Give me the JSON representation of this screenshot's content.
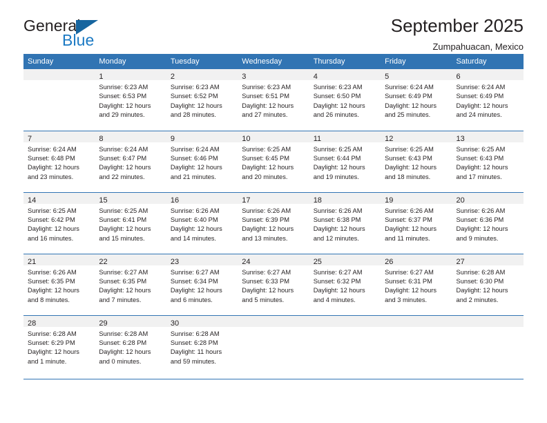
{
  "brand": {
    "name_top": "General",
    "name_bottom": "Blue",
    "flag_icon": "triangle-flag-icon",
    "accent_color": "#1b79c3"
  },
  "header": {
    "title": "September 2025",
    "subtitle": "Zumpahuacan, Mexico"
  },
  "theme": {
    "header_blue": "#3174b3",
    "daynum_strip": "#f1f1f1",
    "text": "#231f20"
  },
  "calendar": {
    "weekdays": [
      "Sunday",
      "Monday",
      "Tuesday",
      "Wednesday",
      "Thursday",
      "Friday",
      "Saturday"
    ],
    "weeks": [
      [
        {
          "day": ""
        },
        {
          "day": "1",
          "sunrise": "Sunrise: 6:23 AM",
          "sunset": "Sunset: 6:53 PM",
          "daylight_line1": "Daylight: 12 hours",
          "daylight_line2": "and 29 minutes."
        },
        {
          "day": "2",
          "sunrise": "Sunrise: 6:23 AM",
          "sunset": "Sunset: 6:52 PM",
          "daylight_line1": "Daylight: 12 hours",
          "daylight_line2": "and 28 minutes."
        },
        {
          "day": "3",
          "sunrise": "Sunrise: 6:23 AM",
          "sunset": "Sunset: 6:51 PM",
          "daylight_line1": "Daylight: 12 hours",
          "daylight_line2": "and 27 minutes."
        },
        {
          "day": "4",
          "sunrise": "Sunrise: 6:23 AM",
          "sunset": "Sunset: 6:50 PM",
          "daylight_line1": "Daylight: 12 hours",
          "daylight_line2": "and 26 minutes."
        },
        {
          "day": "5",
          "sunrise": "Sunrise: 6:24 AM",
          "sunset": "Sunset: 6:49 PM",
          "daylight_line1": "Daylight: 12 hours",
          "daylight_line2": "and 25 minutes."
        },
        {
          "day": "6",
          "sunrise": "Sunrise: 6:24 AM",
          "sunset": "Sunset: 6:49 PM",
          "daylight_line1": "Daylight: 12 hours",
          "daylight_line2": "and 24 minutes."
        }
      ],
      [
        {
          "day": "7",
          "sunrise": "Sunrise: 6:24 AM",
          "sunset": "Sunset: 6:48 PM",
          "daylight_line1": "Daylight: 12 hours",
          "daylight_line2": "and 23 minutes."
        },
        {
          "day": "8",
          "sunrise": "Sunrise: 6:24 AM",
          "sunset": "Sunset: 6:47 PM",
          "daylight_line1": "Daylight: 12 hours",
          "daylight_line2": "and 22 minutes."
        },
        {
          "day": "9",
          "sunrise": "Sunrise: 6:24 AM",
          "sunset": "Sunset: 6:46 PM",
          "daylight_line1": "Daylight: 12 hours",
          "daylight_line2": "and 21 minutes."
        },
        {
          "day": "10",
          "sunrise": "Sunrise: 6:25 AM",
          "sunset": "Sunset: 6:45 PM",
          "daylight_line1": "Daylight: 12 hours",
          "daylight_line2": "and 20 minutes."
        },
        {
          "day": "11",
          "sunrise": "Sunrise: 6:25 AM",
          "sunset": "Sunset: 6:44 PM",
          "daylight_line1": "Daylight: 12 hours",
          "daylight_line2": "and 19 minutes."
        },
        {
          "day": "12",
          "sunrise": "Sunrise: 6:25 AM",
          "sunset": "Sunset: 6:43 PM",
          "daylight_line1": "Daylight: 12 hours",
          "daylight_line2": "and 18 minutes."
        },
        {
          "day": "13",
          "sunrise": "Sunrise: 6:25 AM",
          "sunset": "Sunset: 6:43 PM",
          "daylight_line1": "Daylight: 12 hours",
          "daylight_line2": "and 17 minutes."
        }
      ],
      [
        {
          "day": "14",
          "sunrise": "Sunrise: 6:25 AM",
          "sunset": "Sunset: 6:42 PM",
          "daylight_line1": "Daylight: 12 hours",
          "daylight_line2": "and 16 minutes."
        },
        {
          "day": "15",
          "sunrise": "Sunrise: 6:25 AM",
          "sunset": "Sunset: 6:41 PM",
          "daylight_line1": "Daylight: 12 hours",
          "daylight_line2": "and 15 minutes."
        },
        {
          "day": "16",
          "sunrise": "Sunrise: 6:26 AM",
          "sunset": "Sunset: 6:40 PM",
          "daylight_line1": "Daylight: 12 hours",
          "daylight_line2": "and 14 minutes."
        },
        {
          "day": "17",
          "sunrise": "Sunrise: 6:26 AM",
          "sunset": "Sunset: 6:39 PM",
          "daylight_line1": "Daylight: 12 hours",
          "daylight_line2": "and 13 minutes."
        },
        {
          "day": "18",
          "sunrise": "Sunrise: 6:26 AM",
          "sunset": "Sunset: 6:38 PM",
          "daylight_line1": "Daylight: 12 hours",
          "daylight_line2": "and 12 minutes."
        },
        {
          "day": "19",
          "sunrise": "Sunrise: 6:26 AM",
          "sunset": "Sunset: 6:37 PM",
          "daylight_line1": "Daylight: 12 hours",
          "daylight_line2": "and 11 minutes."
        },
        {
          "day": "20",
          "sunrise": "Sunrise: 6:26 AM",
          "sunset": "Sunset: 6:36 PM",
          "daylight_line1": "Daylight: 12 hours",
          "daylight_line2": "and 9 minutes."
        }
      ],
      [
        {
          "day": "21",
          "sunrise": "Sunrise: 6:26 AM",
          "sunset": "Sunset: 6:35 PM",
          "daylight_line1": "Daylight: 12 hours",
          "daylight_line2": "and 8 minutes."
        },
        {
          "day": "22",
          "sunrise": "Sunrise: 6:27 AM",
          "sunset": "Sunset: 6:35 PM",
          "daylight_line1": "Daylight: 12 hours",
          "daylight_line2": "and 7 minutes."
        },
        {
          "day": "23",
          "sunrise": "Sunrise: 6:27 AM",
          "sunset": "Sunset: 6:34 PM",
          "daylight_line1": "Daylight: 12 hours",
          "daylight_line2": "and 6 minutes."
        },
        {
          "day": "24",
          "sunrise": "Sunrise: 6:27 AM",
          "sunset": "Sunset: 6:33 PM",
          "daylight_line1": "Daylight: 12 hours",
          "daylight_line2": "and 5 minutes."
        },
        {
          "day": "25",
          "sunrise": "Sunrise: 6:27 AM",
          "sunset": "Sunset: 6:32 PM",
          "daylight_line1": "Daylight: 12 hours",
          "daylight_line2": "and 4 minutes."
        },
        {
          "day": "26",
          "sunrise": "Sunrise: 6:27 AM",
          "sunset": "Sunset: 6:31 PM",
          "daylight_line1": "Daylight: 12 hours",
          "daylight_line2": "and 3 minutes."
        },
        {
          "day": "27",
          "sunrise": "Sunrise: 6:28 AM",
          "sunset": "Sunset: 6:30 PM",
          "daylight_line1": "Daylight: 12 hours",
          "daylight_line2": "and 2 minutes."
        }
      ],
      [
        {
          "day": "28",
          "sunrise": "Sunrise: 6:28 AM",
          "sunset": "Sunset: 6:29 PM",
          "daylight_line1": "Daylight: 12 hours",
          "daylight_line2": "and 1 minute."
        },
        {
          "day": "29",
          "sunrise": "Sunrise: 6:28 AM",
          "sunset": "Sunset: 6:28 PM",
          "daylight_line1": "Daylight: 12 hours",
          "daylight_line2": "and 0 minutes."
        },
        {
          "day": "30",
          "sunrise": "Sunrise: 6:28 AM",
          "sunset": "Sunset: 6:28 PM",
          "daylight_line1": "Daylight: 11 hours",
          "daylight_line2": "and 59 minutes."
        },
        {
          "day": ""
        },
        {
          "day": ""
        },
        {
          "day": ""
        },
        {
          "day": ""
        }
      ]
    ]
  }
}
